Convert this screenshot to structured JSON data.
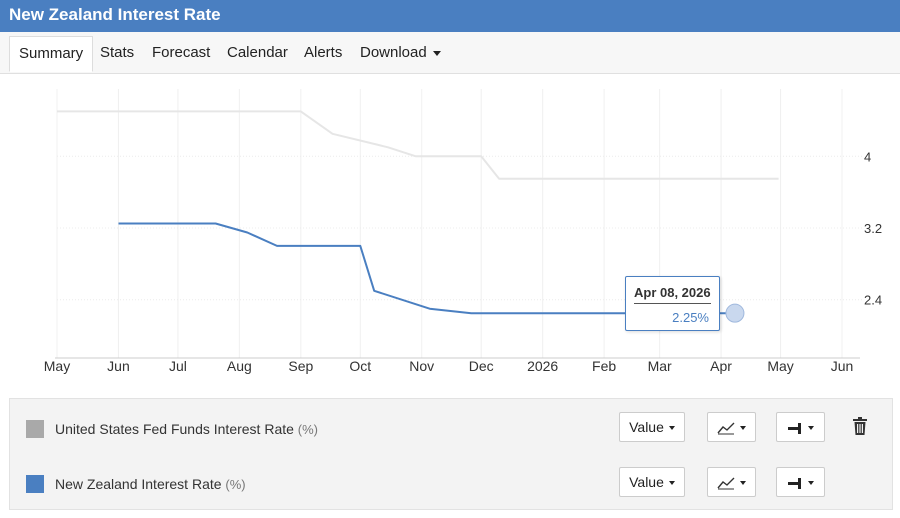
{
  "page": {
    "title": "New Zealand Interest Rate"
  },
  "tabs": [
    {
      "label": "Summary"
    },
    {
      "label": "Stats"
    },
    {
      "label": "Forecast"
    },
    {
      "label": "Calendar"
    },
    {
      "label": "Alerts"
    },
    {
      "label": "Download"
    }
  ],
  "chart_data": {
    "type": "line",
    "x_tick_labels": [
      "May",
      "Jun",
      "Jul",
      "Aug",
      "Sep",
      "Oct",
      "Nov",
      "Dec",
      "2026",
      "Feb",
      "Mar",
      "Apr",
      "May",
      "Jun"
    ],
    "y_tick_labels": [
      "4",
      "3.2",
      "2.4"
    ],
    "ylim": [
      1.75,
      4.75
    ],
    "xlim": [
      "2025-05-01",
      "2026-06-30"
    ],
    "grid": true,
    "series": [
      {
        "name": "United States Fed Funds Interest Rate",
        "unit": "%",
        "color": "#e6e6e6",
        "points": [
          [
            "2025-05-01",
            4.5
          ],
          [
            "2025-09-01",
            4.5
          ],
          [
            "2025-09-17",
            4.25
          ],
          [
            "2025-10-15",
            4.1
          ],
          [
            "2025-10-29",
            4.0
          ],
          [
            "2025-12-01",
            4.0
          ],
          [
            "2025-12-10",
            3.75
          ],
          [
            "2026-04-30",
            3.75
          ]
        ]
      },
      {
        "name": "New Zealand Interest Rate",
        "unit": "%",
        "color": "#4a7fc1",
        "points": [
          [
            "2025-06-01",
            3.25
          ],
          [
            "2025-07-20",
            3.25
          ],
          [
            "2025-08-05",
            3.15
          ],
          [
            "2025-08-20",
            3.0
          ],
          [
            "2025-10-01",
            3.0
          ],
          [
            "2025-10-08",
            2.5
          ],
          [
            "2025-11-05",
            2.3
          ],
          [
            "2025-11-26",
            2.25
          ],
          [
            "2026-04-08",
            2.25
          ]
        ]
      }
    ],
    "tooltip": {
      "date": "Apr 08, 2026",
      "value": "2.25%"
    }
  },
  "legend": [
    {
      "name": "United States Fed Funds Interest Rate",
      "unit": "(%)",
      "color": "#a9a9a9"
    },
    {
      "name": "New Zealand Interest Rate",
      "unit": "(%)",
      "color": "#4a7fc1"
    }
  ],
  "controls": {
    "value_label": "Value"
  },
  "icons": {
    "line_type": "line-chart-icon",
    "axis": "axis-position-icon",
    "delete": "trash-icon",
    "dropdown": "chevron-down-icon"
  }
}
